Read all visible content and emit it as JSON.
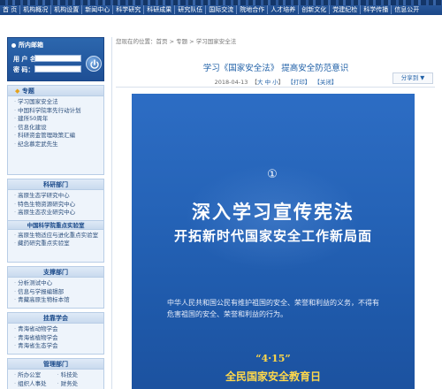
{
  "nav": {
    "items": [
      "首 页",
      "机构概况",
      "机构设置",
      "新闻中心",
      "科学研究",
      "科研成果",
      "研究队伍",
      "国际交流",
      "院地合作",
      "人才培养",
      "创新文化",
      "党建纪检",
      "科学传播",
      "信息公开"
    ]
  },
  "login": {
    "title": "所内邮箱",
    "username_label": "用 户 名：",
    "password_label": "密    码："
  },
  "sidebar": {
    "topics": {
      "title": "专题",
      "items": [
        "学习国家安全法",
        "中国科学院率先行动计划",
        "建所50周年",
        "信息化建设",
        "科研资金管理政策汇编",
        "纪念慕定武先生"
      ]
    },
    "research": {
      "title": "科研部门",
      "items": [
        "高原生态学研究中心",
        "特色生物资源研究中心",
        "高原生态农业研究中心"
      ],
      "lab_title": "中国科学院重点实验室",
      "lab_items": [
        "高原生物适应与进化重点实验室",
        "藏药研究重点实验室"
      ]
    },
    "support": {
      "title": "支撑部门",
      "items": [
        "分析测试中心",
        "信息与学报编辑部",
        "青藏高原生物标本馆"
      ]
    },
    "affiliated": {
      "title": "挂靠学会",
      "items": [
        "青海省动物学会",
        "青海省植物学会",
        "青海省生态学会"
      ]
    },
    "admin": {
      "title": "管理部门",
      "items": [
        "所办公室",
        "科技处",
        "组织人事处",
        "财务处"
      ]
    }
  },
  "main": {
    "breadcrumb": {
      "prefix": "您现在的位置：",
      "home": "首页",
      "sep1": " > ",
      "section": "专题",
      "sep2": " > ",
      "current": "学习国家安全法"
    },
    "title": "学习《国家安全法》 提高安全防范意识",
    "date": "2018-04-13",
    "font_open": "【",
    "font_large": "大",
    "font_medium": "中",
    "font_small": "小",
    "font_close": "】",
    "print": "【打印】",
    "close": "【关闭】",
    "share_label": "分享到",
    "share_caret": "▼"
  },
  "poster": {
    "number": "①",
    "headline": "深入学习宣传宪法",
    "subheadline": "开拓新时代国家安全工作新局面",
    "body": "中华人民共和国公民有维护祖国的安全、荣誉和利益的义务，不得有危害祖国的安全、荣誉和利益的行为。",
    "date": "“4·15”",
    "day": "全民国家安全教育日"
  },
  "colors": {
    "nav_bg": "#1b4787",
    "title_blue": "#2262a8",
    "poster_blue": "#2563b7",
    "poster_gold": "#ffd84a"
  }
}
